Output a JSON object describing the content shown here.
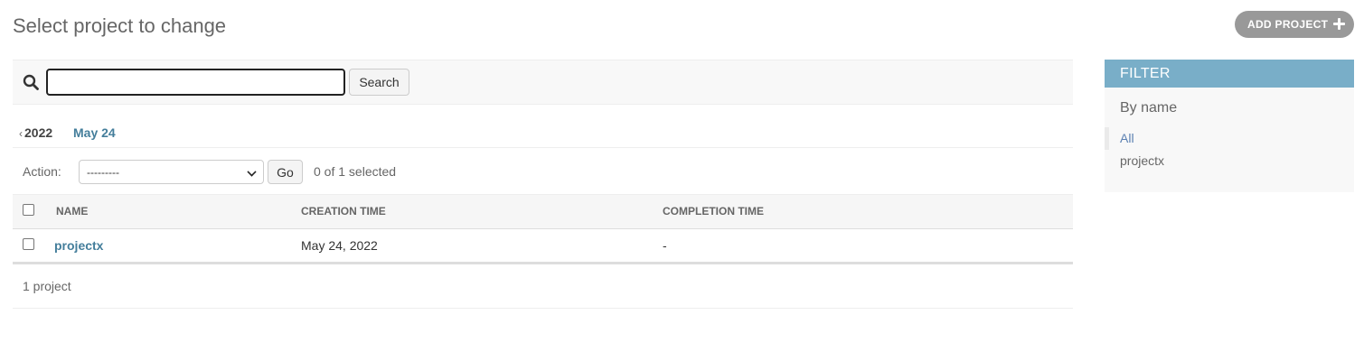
{
  "page": {
    "title": "Select project to change"
  },
  "header": {
    "add_button_label": "ADD PROJECT",
    "add_icon": "plus-icon"
  },
  "search": {
    "icon": "search-icon",
    "value": "",
    "button_label": "Search"
  },
  "date_hierarchy": {
    "back_chevron": "‹",
    "year": "2022",
    "month": "May 24"
  },
  "actions": {
    "label": "Action:",
    "selected_option": "---------",
    "go_label": "Go",
    "counter": "0 of 1 selected"
  },
  "table": {
    "columns": [
      "NAME",
      "CREATION TIME",
      "COMPLETION TIME"
    ],
    "rows": [
      {
        "name": "projectx",
        "creation_time": "May 24, 2022",
        "completion_time": "-"
      }
    ]
  },
  "paginator": {
    "text": "1 project"
  },
  "filter": {
    "header": "FILTER",
    "by_label": "By name",
    "options": [
      "All",
      "projectx"
    ],
    "selected": "All"
  },
  "colors": {
    "link": "#447e9b",
    "filter_header": "#79aec8",
    "add_button": "#999999"
  }
}
